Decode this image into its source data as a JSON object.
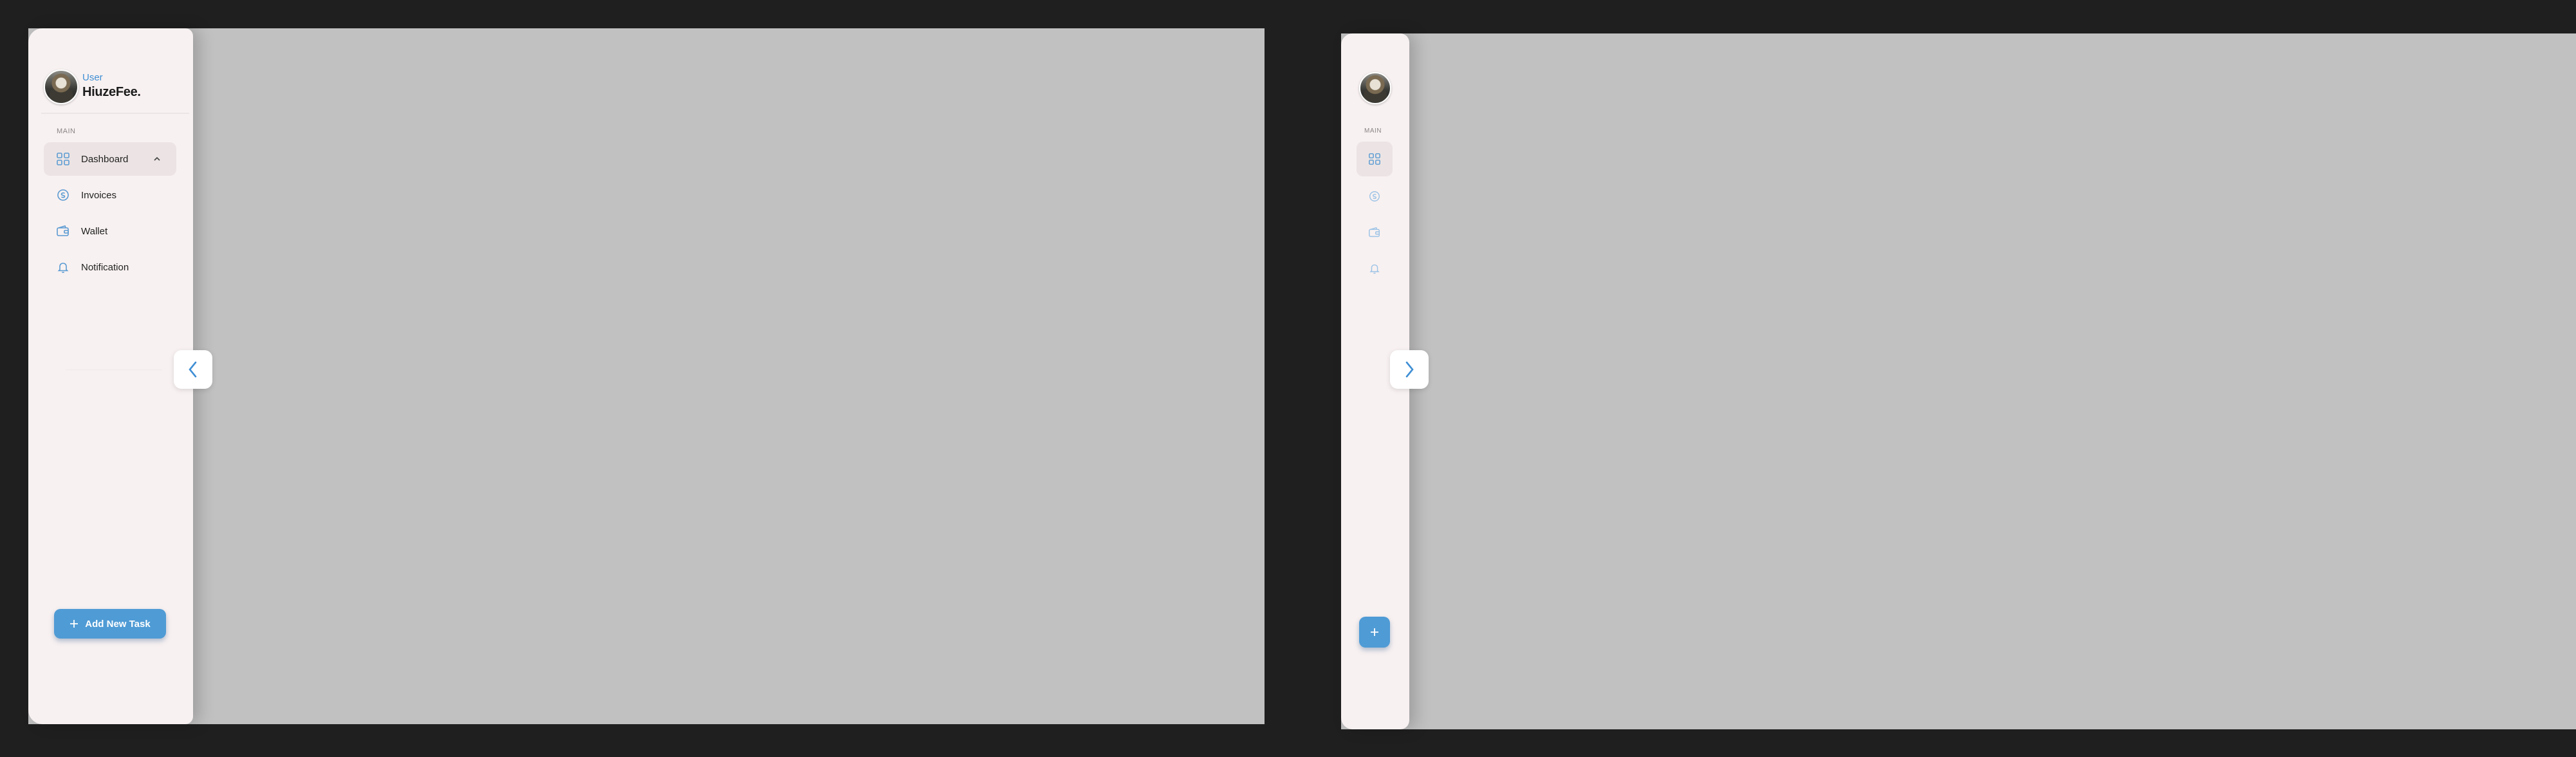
{
  "expanded": {
    "user": {
      "role_label": "User",
      "name": "HiuzeFee."
    },
    "section_label": "MAIN",
    "nav": [
      {
        "label": "Dashboard",
        "icon": "grid-icon",
        "active": true
      },
      {
        "label": "Invoices",
        "icon": "invoice-icon",
        "active": false
      },
      {
        "label": "Wallet",
        "icon": "wallet-icon",
        "active": false
      },
      {
        "label": "Notification",
        "icon": "bell-icon",
        "active": false
      }
    ],
    "add_button_label": "Add New Task",
    "toggle_icon": "chevron-left-icon"
  },
  "collapsed": {
    "section_label": "MAIN",
    "nav_icons": [
      "grid-icon",
      "invoice-icon",
      "wallet-icon",
      "bell-icon"
    ],
    "toggle_icon": "chevron-right-icon",
    "add_icon": "plus-icon"
  },
  "colors": {
    "accent": "#4f9bd5",
    "sidebar_bg": "#f8f1f1",
    "content_bg": "#c1c1c1",
    "page_bg": "#1f1f1f"
  }
}
